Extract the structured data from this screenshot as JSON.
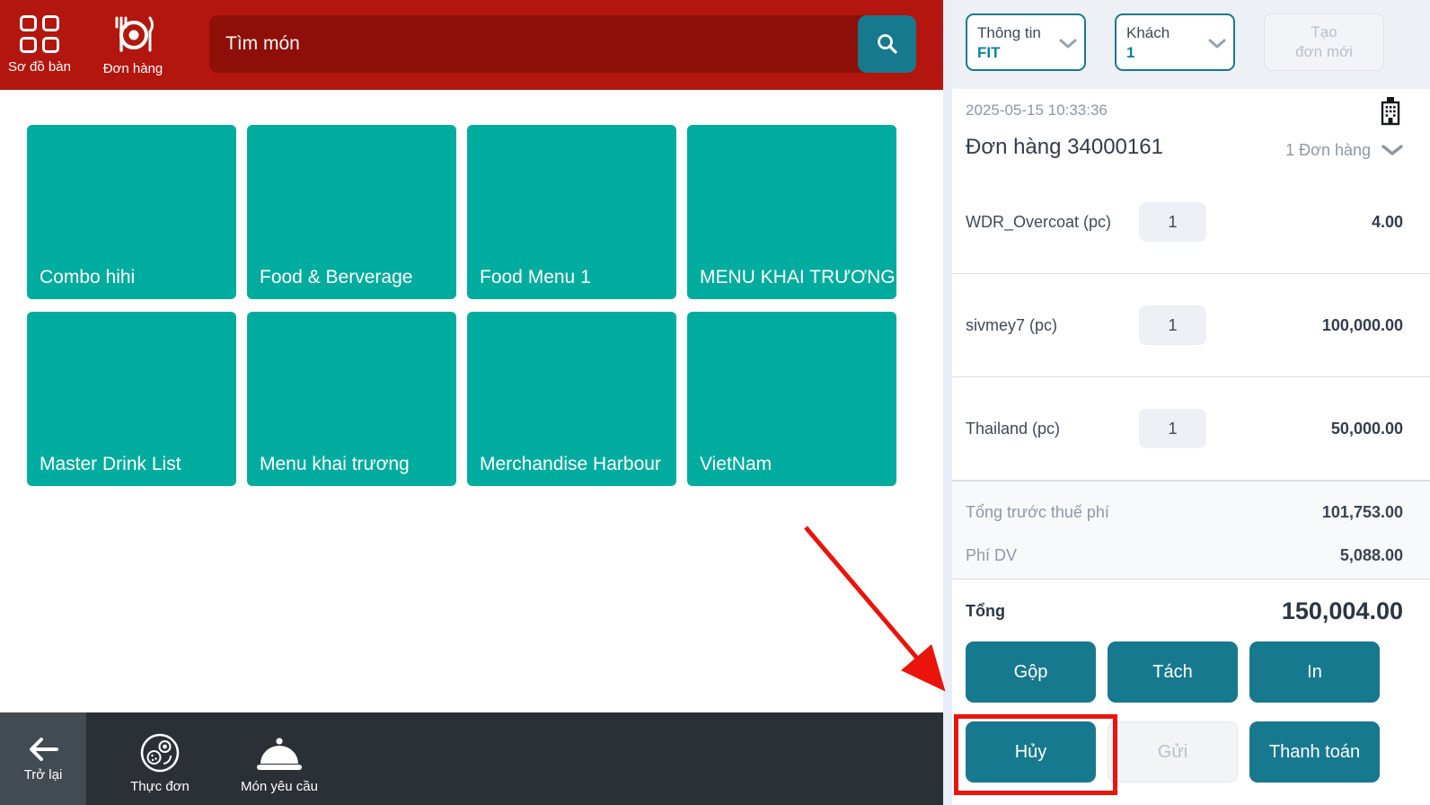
{
  "colors": {
    "brand_red": "#b2160e",
    "search_field_red": "#8e0f08",
    "accent_teal": "#17798e",
    "tile_teal": "#00ac9e",
    "annotation_red": "#ea140c",
    "footer_dark": "#2b3036",
    "panel_topbar_gray": "#edf0f4"
  },
  "left": {
    "nav": {
      "tables_label": "Sơ đồ bàn",
      "orders_label": "Đơn hàng"
    },
    "search": {
      "placeholder": "Tìm món"
    },
    "tiles": [
      "Combo hihi",
      "Food & Berverage",
      "Food Menu 1",
      "MENU KHAI TRƯƠNG",
      "Master Drink List",
      "Menu khai trương",
      "Merchandise Harbour",
      "VietNam"
    ],
    "footer": {
      "back_label": "Trở lại",
      "menu_label": "Thực đơn",
      "request_label": "Món yêu cầu"
    }
  },
  "panel": {
    "info_dropdown": {
      "label": "Thông tin",
      "value": "FIT"
    },
    "guest_dropdown": {
      "label": "Khách",
      "value": "1"
    },
    "new_order_label": "Tạo\nđơn mới",
    "timestamp": "2025-05-15 10:33:36",
    "order_title": "Đơn hàng 34000161",
    "order_count": "1 Đơn hàng",
    "items": [
      {
        "name": "WDR_Overcoat (pc)",
        "qty": "1",
        "price": "4.00"
      },
      {
        "name": "sivmey7 (pc)",
        "qty": "1",
        "price": "100,000.00"
      },
      {
        "name": "Thailand (pc)",
        "qty": "1",
        "price": "50,000.00"
      }
    ],
    "totals": {
      "subtotal_label": "Tổng trước thuế phí",
      "subtotal_value": "101,753.00",
      "fee_label": "Phí DV",
      "fee_value": "5,088.00",
      "total_label": "Tổng",
      "total_value": "150,004.00"
    },
    "actions": {
      "merge": "Gộp",
      "split": "Tách",
      "print": "In",
      "cancel": "Hủy",
      "send": "Gửi",
      "pay": "Thanh toán"
    }
  }
}
